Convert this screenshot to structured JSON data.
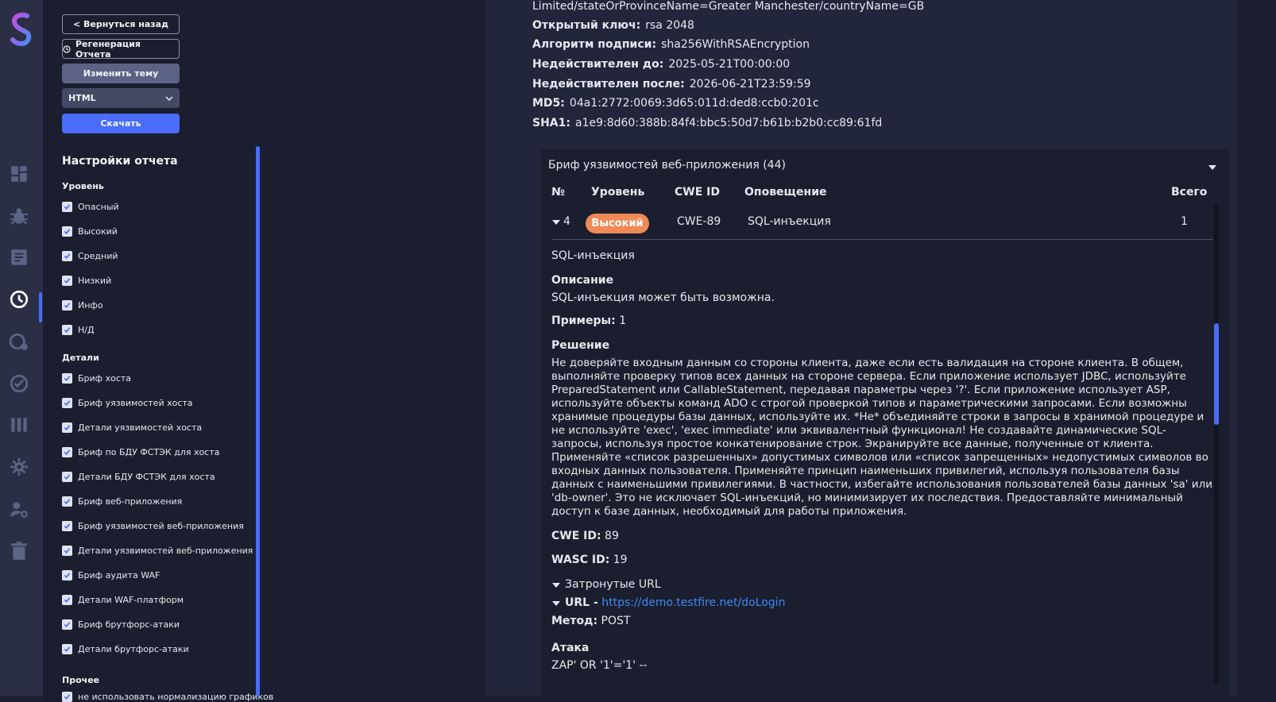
{
  "sidebar_nav": {
    "icons": [
      "logo-icon",
      "dashboard-icon",
      "bug-icon",
      "report-list-icon",
      "reports-icon",
      "scan-settings-icon",
      "audit-icon",
      "library-icon",
      "settings-icon",
      "user-settings-icon",
      "trash-icon"
    ]
  },
  "settings_panel": {
    "back_button": "< Вернуться назад",
    "regen_button": "Регенерация Отчета",
    "theme_button": "Изменить тему",
    "format_select": "HTML",
    "download_button": "Скачать",
    "title": "Настройки отчета",
    "level_section": "Уровень",
    "levels": [
      "Опасный",
      "Высокий",
      "Средний",
      "Низкий",
      "Инфо",
      "Н/Д"
    ],
    "details_section": "Детали",
    "details": [
      "Бриф хоста",
      "Бриф уязвимостей хоста",
      "Детали уязвимостей хоста",
      "Бриф по БДУ ФСТЭК для хоста",
      "Детали БДУ ФСТЭК для хоста",
      "Бриф веб-приложения",
      "Бриф уязвимостей веб-приложения",
      "Детали уязвимостей веб-приложения",
      "Бриф аудита WAF",
      "Детали WAF-платформ",
      "Бриф брутфорс-атаки",
      "Детали брутфорс-атаки"
    ],
    "other_section": "Прочее",
    "other": [
      "не использовать нормализацию графиков"
    ]
  },
  "cert": {
    "subject_tail": "Limited/stateOrProvinceName=Greater Manchester/countryName=GB",
    "pubkey_label": "Открытый ключ:",
    "pubkey_value": "rsa 2048",
    "sigalg_label": "Алгоритм подписи:",
    "sigalg_value": "sha256WithRSAEncryption",
    "notbefore_label": "Недействителен до:",
    "notbefore_value": "2025-05-21T00:00:00",
    "notafter_label": "Недействителен после:",
    "notafter_value": "2026-06-21T23:59:59",
    "md5_label": "MD5:",
    "md5_value": "04a1:2772:0069:3d65:011d:ded8:ccb0:201c",
    "sha1_label": "SHA1:",
    "sha1_value": "a1e9:8d60:388b:84f4:bbc5:50d7:b61b:b2b0:cc89:61fd"
  },
  "vuln_brief": {
    "title": "Бриф уязвимостей веб-приложения (44)",
    "columns": [
      "№",
      "Уровень",
      "CWE ID",
      "Оповещение",
      "Всего"
    ],
    "row": {
      "num": "4",
      "level": "Высокий",
      "level_color": "#ef8a57",
      "cwe": "CWE-89",
      "alert": "SQL-инъекция",
      "total": "1"
    },
    "detail": {
      "name": "SQL-инъекция",
      "desc_label": "Описание",
      "desc": "SQL-инъекция может быть возможна.",
      "examples_label": "Примеры:",
      "examples_value": "1",
      "solution_label": "Решение",
      "solution": "Не доверяйте входным данным со стороны клиента, даже если есть валидация на стороне клиента. В общем, выполняйте проверку типов всех данных на стороне сервера. Если приложение использует JDBC, используйте PreparedStatement или CallableStatement, передавая параметры через '?'. Если приложение использует ASP, используйте объекты команд ADO с строгой проверкой типов и параметрическими запросами. Если возможны хранимые процедуры базы данных, используйте их. *Не* объединяйте строки в запросы в хранимой процедуре и не используйте 'exec', 'exec immediate' или эквивалентный функционал! Не создавайте динамические SQL-запросы, используя простое конкатенирование строк. Экранируйте все данные, полученные от клиента. Применяйте «список разрешенных» допустимых символов или «список запрещенных» недопустимых символов во входных данных пользователя. Применяйте принцип наименьших привилегий, используя пользователя базы данных с наименьшими привилегиями. В частности, избегайте использования пользователей базы данных 'sa' или 'db-owner'. Это не исключает SQL-инъекций, но минимизирует их последствия. Предоставляйте минимальный доступ к базе данных, необходимый для работы приложения.",
      "cwe_label": "CWE ID:",
      "cwe_value": "89",
      "wasc_label": "WASC ID:",
      "wasc_value": "19",
      "affected_label": "Затронутые URL",
      "url_label": "URL -",
      "url": "https://demo.testfire.net/doLogin",
      "method_label": "Метод:",
      "method_value": "POST",
      "attack_label": "Атака",
      "attack_value": "ZAP' OR '1'='1' --"
    }
  },
  "colors": {
    "accent": "#4a6cf7",
    "badge_high": "#ef8a57",
    "link": "#3d8af7"
  }
}
